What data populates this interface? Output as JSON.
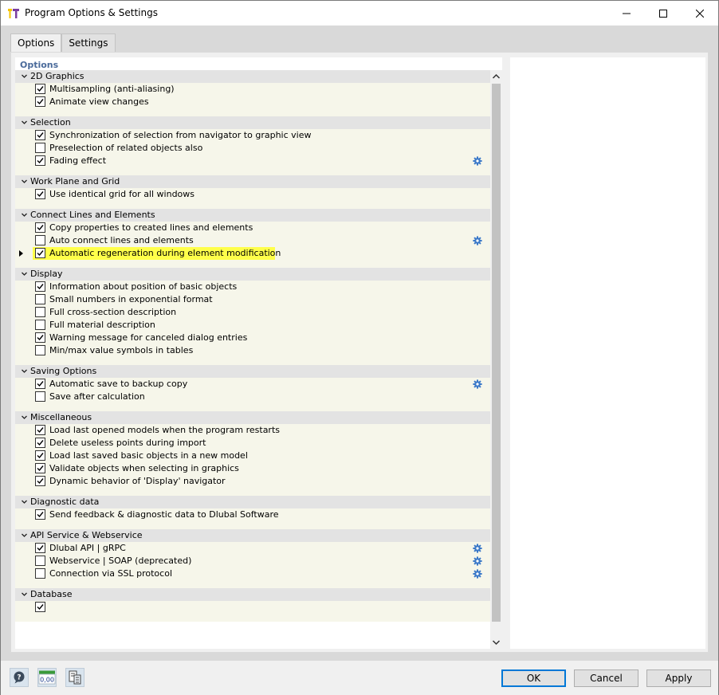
{
  "window": {
    "title": "Program Options & Settings"
  },
  "tabs": [
    {
      "label": "Options",
      "active": true
    },
    {
      "label": "Settings",
      "active": false
    }
  ],
  "panel_title": "Options",
  "groups": [
    {
      "title": "2D Graphics",
      "items": [
        {
          "label": "Multisampling (anti-aliasing)",
          "checked": true,
          "gear": false
        },
        {
          "label": "Animate view changes",
          "checked": true,
          "gear": false
        }
      ]
    },
    {
      "title": "Selection",
      "items": [
        {
          "label": "Synchronization of selection from navigator to graphic view",
          "checked": true,
          "gear": false
        },
        {
          "label": "Preselection of related objects also",
          "checked": false,
          "gear": false
        },
        {
          "label": "Fading effect",
          "checked": true,
          "gear": true
        }
      ]
    },
    {
      "title": "Work Plane and Grid",
      "items": [
        {
          "label": "Use identical grid for all windows",
          "checked": true,
          "gear": false
        }
      ]
    },
    {
      "title": "Connect Lines and Elements",
      "items": [
        {
          "label": "Copy properties to created lines and elements",
          "checked": true,
          "gear": false
        },
        {
          "label": "Auto connect lines and elements",
          "checked": false,
          "gear": true
        },
        {
          "label": "Automatic regeneration during element modification",
          "checked": true,
          "gear": false,
          "highlighted": true,
          "current": true
        }
      ]
    },
    {
      "title": "Display",
      "items": [
        {
          "label": "Information about position of basic objects",
          "checked": true,
          "gear": false
        },
        {
          "label": "Small numbers in exponential format",
          "checked": false,
          "gear": false
        },
        {
          "label": "Full cross-section description",
          "checked": false,
          "gear": false
        },
        {
          "label": "Full material description",
          "checked": false,
          "gear": false
        },
        {
          "label": "Warning message for canceled dialog entries",
          "checked": true,
          "gear": false
        },
        {
          "label": "Min/max value symbols in tables",
          "checked": false,
          "gear": false
        }
      ]
    },
    {
      "title": "Saving Options",
      "items": [
        {
          "label": "Automatic save to backup copy",
          "checked": true,
          "gear": true
        },
        {
          "label": "Save after calculation",
          "checked": false,
          "gear": false
        }
      ]
    },
    {
      "title": "Miscellaneous",
      "items": [
        {
          "label": "Load last opened models when the program restarts",
          "checked": true,
          "gear": false
        },
        {
          "label": "Delete useless points during import",
          "checked": true,
          "gear": false
        },
        {
          "label": "Load last saved basic objects in a new model",
          "checked": true,
          "gear": false
        },
        {
          "label": "Validate objects when selecting in graphics",
          "checked": true,
          "gear": false
        },
        {
          "label": "Dynamic behavior of 'Display' navigator",
          "checked": true,
          "gear": false
        }
      ]
    },
    {
      "title": "Diagnostic data",
      "items": [
        {
          "label": "Send feedback & diagnostic data to Dlubal Software",
          "checked": true,
          "gear": false
        }
      ]
    },
    {
      "title": "API Service & Webservice",
      "items": [
        {
          "label": "Dlubal API | gRPC",
          "checked": true,
          "gear": true
        },
        {
          "label": "Webservice | SOAP (deprecated)",
          "checked": false,
          "gear": true
        },
        {
          "label": "Connection via SSL protocol",
          "checked": false,
          "gear": true
        }
      ]
    },
    {
      "title": "Database",
      "items": [
        {
          "label": "",
          "checked": true,
          "gear": false
        }
      ]
    }
  ],
  "footer": {
    "tools": [
      "help-icon",
      "units-decimal-icon",
      "clipboard-settings-icon"
    ],
    "units_icon_text": "0,00",
    "ok_label": "OK",
    "cancel_label": "Cancel",
    "apply_label": "Apply"
  },
  "colors": {
    "highlight": "#ffff4a",
    "group_header": "#e3e3e3",
    "group_body": "#f6f6ea",
    "accent": "#0078d7",
    "panel_title": "#4a6a9a",
    "gear": "#3a78c8"
  }
}
